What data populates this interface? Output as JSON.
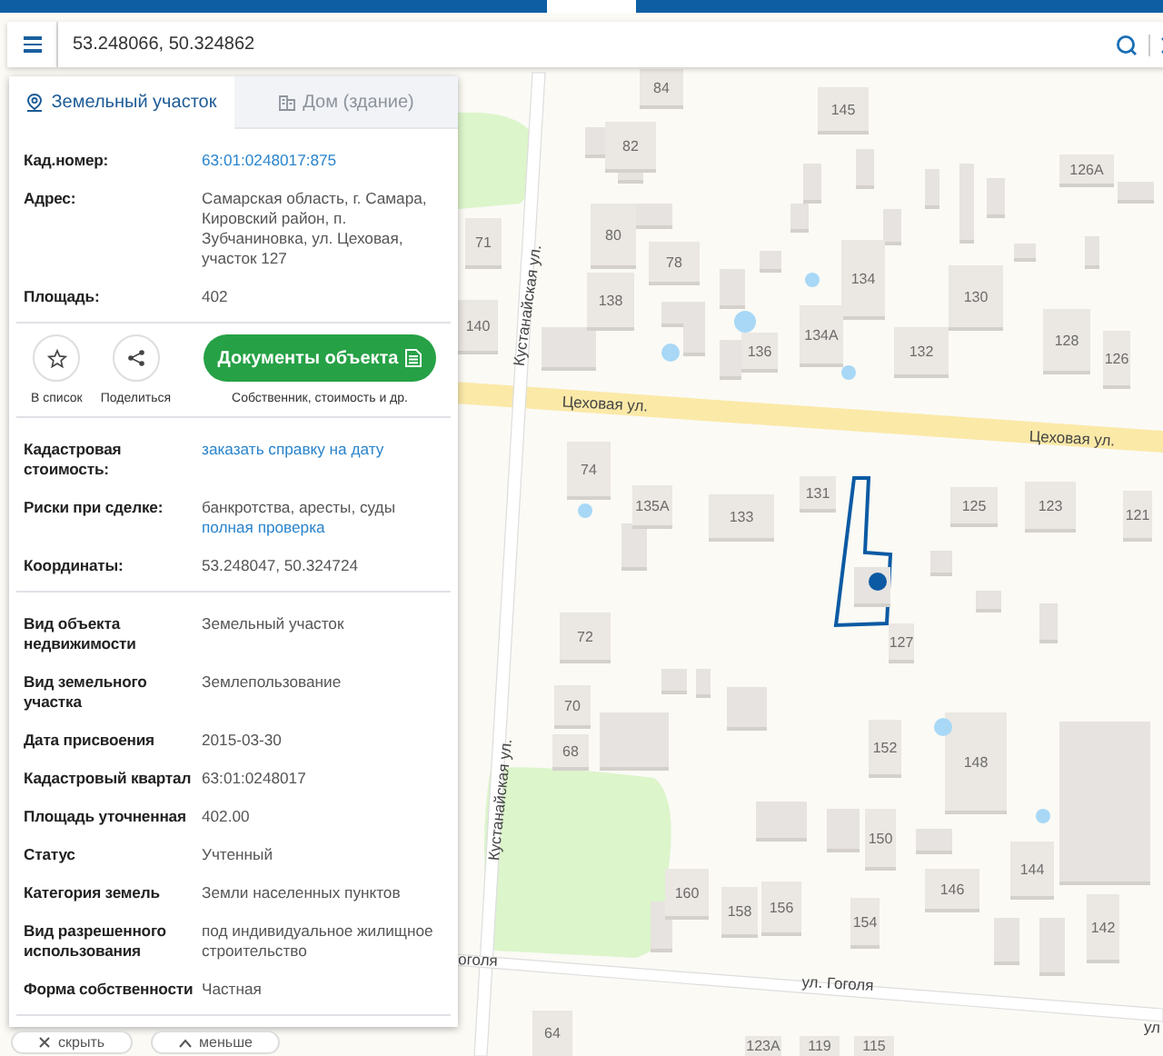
{
  "search": {
    "value": "53.248066, 50.324862"
  },
  "tabs": [
    {
      "label": "Земельный участок",
      "selected": true
    },
    {
      "label": "Дом (здание)",
      "selected": false
    }
  ],
  "sections": [
    {
      "rows": [
        {
          "label": "Кад.номер:",
          "link": "63:01:0248017:875"
        },
        {
          "label": "Адрес:",
          "value": "Самарская область, г. Самара, Кировский район, п. Зубчаниновка, ул. Цеховая, участок 127"
        },
        {
          "label": "Площадь:",
          "value": "402"
        }
      ]
    },
    {
      "rows": [
        {
          "label": "Кадастровая стоимость:",
          "link": "заказать справку на дату"
        },
        {
          "label": "Риски при сделке:",
          "value": "банкротства, аресты, суды",
          "link": "полная проверка"
        },
        {
          "label": "Координаты:",
          "value": "53.248047, 50.324724"
        }
      ]
    },
    {
      "rows": [
        {
          "label": "Вид объекта недвижимости",
          "value": "Земельный участок"
        },
        {
          "label": "Вид земельного участка",
          "value": "Землепользование"
        },
        {
          "label": "Дата присвоения",
          "value": "2015-03-30"
        },
        {
          "label": "Кадастровый квартал",
          "value": "63:01:0248017"
        },
        {
          "label": "Площадь уточненная",
          "value": "402.00"
        },
        {
          "label": "Статус",
          "value": "Учтенный"
        },
        {
          "label": "Категория земель",
          "value": "Земли населенных пунктов"
        },
        {
          "label": "Вид разрешенного использования",
          "value": "под индивидуальное жилищное строительство"
        },
        {
          "label": "Форма собственности",
          "value": "Частная"
        }
      ]
    }
  ],
  "actions": [
    {
      "kind": "favorite",
      "caption": "В список"
    },
    {
      "kind": "share",
      "caption": "Поделиться"
    },
    {
      "kind": "documents",
      "label": "Документы объекта",
      "caption": "Собственник, стоимость и др."
    }
  ],
  "bottom_buttons": [
    {
      "kind": "hide",
      "label": "скрыть"
    },
    {
      "kind": "less",
      "label": "меньше"
    }
  ],
  "map": {
    "streets": [
      "Цеховая ул.",
      "Цеховая ул.",
      "Кустанайская ул.",
      "Кустанайская ул.",
      "ул. Гоголя",
      "оголя",
      "ул"
    ],
    "buildings": [
      "84",
      "145",
      "82",
      "126А",
      "71",
      "80",
      "78",
      "134",
      "130",
      "138",
      "140",
      "136",
      "134А",
      "132",
      "128",
      "126",
      "74",
      "135А",
      "133",
      "131",
      "125",
      "123",
      "121",
      "72",
      "127",
      "70",
      "68",
      "152",
      "148",
      "150",
      "144",
      "146",
      "160",
      "158",
      "156",
      "154",
      "142",
      "64",
      "123А",
      "119",
      "115"
    ]
  }
}
